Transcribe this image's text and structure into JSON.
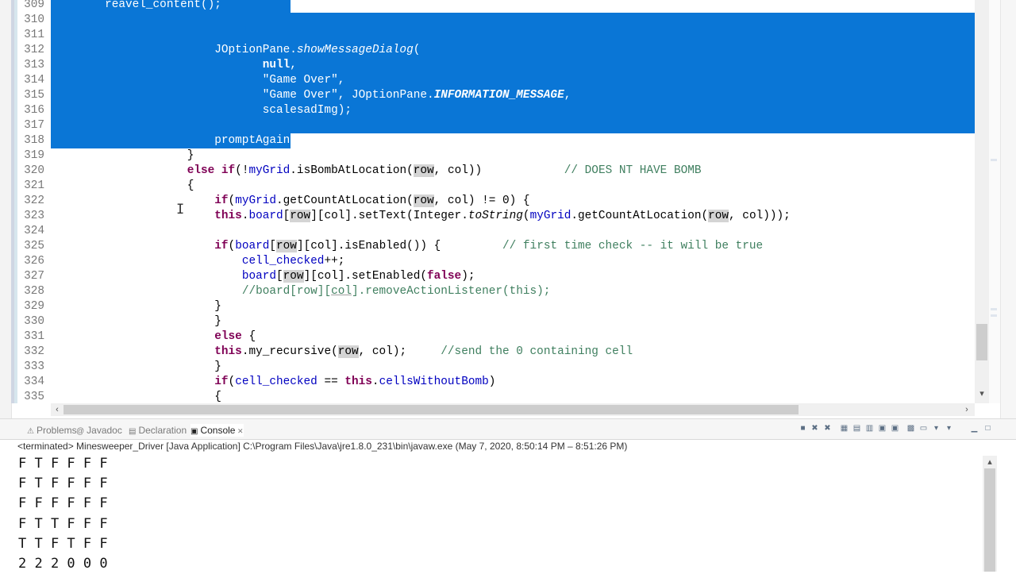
{
  "editor": {
    "lines": [
      {
        "n": "309",
        "sel": "partial",
        "seg": [
          [
            "",
            "        "
          ],
          [
            "",
            "reavel_content();"
          ]
        ]
      },
      {
        "n": "310",
        "sel": "full",
        "seg": []
      },
      {
        "n": "311",
        "sel": "full",
        "seg": []
      },
      {
        "n": "312",
        "sel": "full",
        "seg": [
          [
            "",
            "                        JOptionPane."
          ],
          [
            "it",
            "showMessageDialog"
          ],
          [
            "",
            "("
          ]
        ]
      },
      {
        "n": "313",
        "sel": "full",
        "seg": [
          [
            "",
            "                               "
          ],
          [
            "k",
            "null"
          ],
          [
            "",
            ","
          ]
        ]
      },
      {
        "n": "314",
        "sel": "full",
        "seg": [
          [
            "",
            "                               "
          ],
          [
            "s",
            "\"Game Over\""
          ],
          [
            "",
            ","
          ]
        ]
      },
      {
        "n": "315",
        "sel": "full",
        "seg": [
          [
            "",
            "                               "
          ],
          [
            "s",
            "\"Game Over\""
          ],
          [
            "",
            ", JOptionPane."
          ],
          [
            "sf",
            "INFORMATION_MESSAGE"
          ],
          [
            "",
            ","
          ]
        ]
      },
      {
        "n": "316",
        "sel": "full",
        "seg": [
          [
            "",
            "                               scalesadImg);"
          ]
        ]
      },
      {
        "n": "317",
        "sel": "full",
        "seg": []
      },
      {
        "n": "318",
        "sel": "partial",
        "seg": [
          [
            "",
            "                        promptAgain();"
          ]
        ]
      },
      {
        "n": "319",
        "sel": "none",
        "seg": [
          [
            "",
            "                    }"
          ]
        ]
      },
      {
        "n": "320",
        "sel": "none",
        "seg": [
          [
            "",
            "                    "
          ],
          [
            "k",
            "else"
          ],
          [
            "",
            " "
          ],
          [
            "k",
            "if"
          ],
          [
            "",
            "(!"
          ],
          [
            "f",
            "myGrid"
          ],
          [
            "",
            ".isBombAtLocation("
          ],
          [
            "hl",
            "row"
          ],
          [
            "",
            ", col))            "
          ],
          [
            "c",
            "// DOES NT HAVE BOMB"
          ]
        ]
      },
      {
        "n": "321",
        "sel": "none",
        "seg": [
          [
            "",
            "                    {"
          ]
        ]
      },
      {
        "n": "322",
        "sel": "none",
        "seg": [
          [
            "",
            "                        "
          ],
          [
            "k",
            "if"
          ],
          [
            "",
            "("
          ],
          [
            "f",
            "myGrid"
          ],
          [
            "",
            ".getCountAtLocation("
          ],
          [
            "hl",
            "row"
          ],
          [
            "",
            ", col) != 0) {"
          ]
        ]
      },
      {
        "n": "323",
        "sel": "none",
        "seg": [
          [
            "",
            "                        "
          ],
          [
            "k",
            "this"
          ],
          [
            "",
            "."
          ],
          [
            "f",
            "board"
          ],
          [
            "",
            "["
          ],
          [
            "hl",
            "row"
          ],
          [
            "",
            "][col].setText(Integer."
          ],
          [
            "it",
            "toString"
          ],
          [
            "",
            "("
          ],
          [
            "f",
            "myGrid"
          ],
          [
            "",
            ".getCountAtLocation("
          ],
          [
            "hl",
            "row"
          ],
          [
            "",
            ", col)));"
          ]
        ]
      },
      {
        "n": "324",
        "sel": "none",
        "seg": []
      },
      {
        "n": "325",
        "sel": "none",
        "seg": [
          [
            "",
            "                        "
          ],
          [
            "k",
            "if"
          ],
          [
            "",
            "("
          ],
          [
            "f",
            "board"
          ],
          [
            "",
            "["
          ],
          [
            "hl",
            "row"
          ],
          [
            "",
            "][col].isEnabled()) {         "
          ],
          [
            "c",
            "// first time check -- it will be true"
          ]
        ]
      },
      {
        "n": "326",
        "sel": "none",
        "seg": [
          [
            "",
            "                            "
          ],
          [
            "f",
            "cell_checked"
          ],
          [
            "",
            "++;"
          ]
        ]
      },
      {
        "n": "327",
        "sel": "none",
        "seg": [
          [
            "",
            "                            "
          ],
          [
            "f",
            "board"
          ],
          [
            "",
            "["
          ],
          [
            "hl",
            "row"
          ],
          [
            "",
            "][col].setEnabled("
          ],
          [
            "k",
            "false"
          ],
          [
            "",
            ");"
          ]
        ]
      },
      {
        "n": "328",
        "sel": "none",
        "seg": [
          [
            "",
            "                            "
          ],
          [
            "c",
            "//board[row]["
          ],
          [
            "c ul",
            "col"
          ],
          [
            "c",
            "].removeActionListener(this);"
          ]
        ]
      },
      {
        "n": "329",
        "sel": "none",
        "seg": [
          [
            "",
            "                        }"
          ]
        ]
      },
      {
        "n": "330",
        "sel": "none",
        "seg": [
          [
            "",
            "                        }"
          ]
        ]
      },
      {
        "n": "331",
        "sel": "none",
        "seg": [
          [
            "",
            "                        "
          ],
          [
            "k",
            "else"
          ],
          [
            "",
            " {"
          ]
        ]
      },
      {
        "n": "332",
        "sel": "none",
        "seg": [
          [
            "",
            "                        "
          ],
          [
            "k",
            "this"
          ],
          [
            "",
            ".my_recursive("
          ],
          [
            "hl",
            "row"
          ],
          [
            "",
            ", col);     "
          ],
          [
            "c",
            "//send the 0 containing cell"
          ]
        ]
      },
      {
        "n": "333",
        "sel": "none",
        "seg": [
          [
            "",
            "                        }"
          ]
        ]
      },
      {
        "n": "334",
        "sel": "none",
        "seg": [
          [
            "",
            "                        "
          ],
          [
            "k",
            "if"
          ],
          [
            "",
            "("
          ],
          [
            "f",
            "cell_checked"
          ],
          [
            "",
            " == "
          ],
          [
            "k",
            "this"
          ],
          [
            "",
            "."
          ],
          [
            "f",
            "cellsWithoutBomb"
          ],
          [
            "",
            ")"
          ]
        ]
      },
      {
        "n": "335",
        "sel": "none",
        "seg": [
          [
            "",
            "                        {"
          ]
        ]
      }
    ]
  },
  "views": {
    "tabs": [
      {
        "label": "Problems",
        "icon": "problems-icon",
        "glyph": "⚠",
        "active": false
      },
      {
        "label": "Javadoc",
        "icon": "javadoc-icon",
        "glyph": "@",
        "active": false
      },
      {
        "label": "Declaration",
        "icon": "declaration-icon",
        "glyph": "▤",
        "active": false
      },
      {
        "label": "Console",
        "icon": "console-icon",
        "glyph": "▣",
        "active": true
      }
    ],
    "toolbar_icons": [
      "terminate-icon",
      "remove-launch-icon",
      "remove-all-icon",
      "clear-console-icon",
      "scroll-lock-icon",
      "word-wrap-icon",
      "show-when-stdout-icon",
      "show-when-stderr-icon",
      "pin-console-icon",
      "display-console-icon",
      "open-console-icon",
      "view-menu-icon",
      "minimize-icon",
      "maximize-icon"
    ]
  },
  "console": {
    "terminated": "<terminated> Minesweeper_Driver [Java Application] C:\\Program Files\\Java\\jre1.8.0_231\\bin\\javaw.exe  (May 7, 2020, 8:50:14 PM – 8:51:26 PM)",
    "output": [
      "F T F F F F",
      "F T F F F F",
      "F F F F F F",
      "F T T F F F",
      "T T F T F F",
      "2 2 2 0 0 0"
    ]
  }
}
